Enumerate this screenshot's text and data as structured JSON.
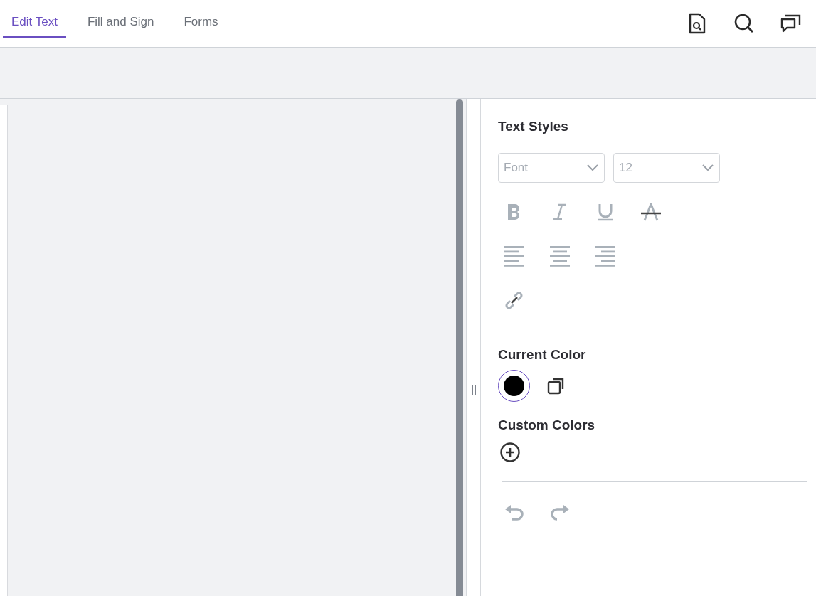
{
  "tabs": [
    {
      "label": "Edit Text",
      "selected": true
    },
    {
      "label": "Fill and Sign",
      "selected": false
    },
    {
      "label": "Forms",
      "selected": false
    }
  ],
  "panel": {
    "text_styles": {
      "title": "Text Styles",
      "font_select": {
        "placeholder": "Font",
        "disabled": true
      },
      "size_select": {
        "value": "12",
        "disabled": true
      },
      "format_buttons": [
        {
          "kind": "bold",
          "disabled": true
        },
        {
          "kind": "italic",
          "disabled": true
        },
        {
          "kind": "underline",
          "disabled": true
        },
        {
          "kind": "strikethrough",
          "disabled": true
        }
      ],
      "align_buttons": [
        {
          "kind": "left",
          "disabled": true
        },
        {
          "kind": "center",
          "disabled": true
        },
        {
          "kind": "right",
          "disabled": true
        }
      ],
      "link_button": {
        "disabled": true
      }
    },
    "current_color": {
      "title": "Current Color",
      "color": "#000000",
      "selected": true
    },
    "custom_colors": {
      "title": "Custom Colors"
    },
    "history": [
      {
        "kind": "undo",
        "disabled": true
      },
      {
        "kind": "redo",
        "disabled": true
      }
    ]
  }
}
